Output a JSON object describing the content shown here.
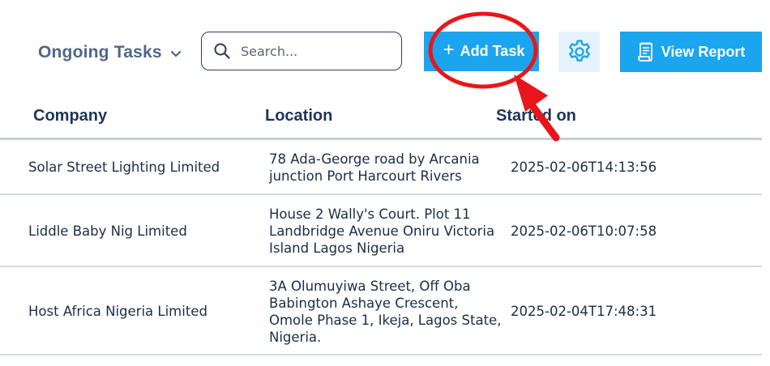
{
  "toolbar": {
    "filter_label": "Ongoing Tasks",
    "search_placeholder": "Search...",
    "add_task_label": "Add Task",
    "add_task_icon": "plus-icon",
    "settings_icon": "gear-icon",
    "view_report_label": "View Report",
    "view_report_icon": "report-icon"
  },
  "table": {
    "columns": [
      "Company",
      "Location",
      "Started on"
    ],
    "rows": [
      {
        "company": "Solar Street Lighting Limited",
        "location": [
          "78 Ada-George road by Arcania",
          "junction Port Harcourt Rivers"
        ],
        "started": "2025-02-06T14:13:56"
      },
      {
        "company": "Liddle Baby Nig Limited",
        "location": [
          "House 2 Wally's Court. Plot 11",
          "Landbridge Avenue Oniru Victoria",
          "Island Lagos Nigeria"
        ],
        "started": "2025-02-06T10:07:58"
      },
      {
        "company": "Host Africa Nigeria Limited",
        "location": [
          "3A Olumuyiwa Street, Off Oba",
          "Babington Ashaye Crescent,",
          "Omole Phase 1, Ikeja, Lagos State,",
          "Nigeria."
        ],
        "started": "2025-02-04T17:48:31"
      }
    ]
  },
  "colors": {
    "accent": "#1aa5ee",
    "header_text": "#1d3557",
    "annotation": "#e8161b"
  }
}
